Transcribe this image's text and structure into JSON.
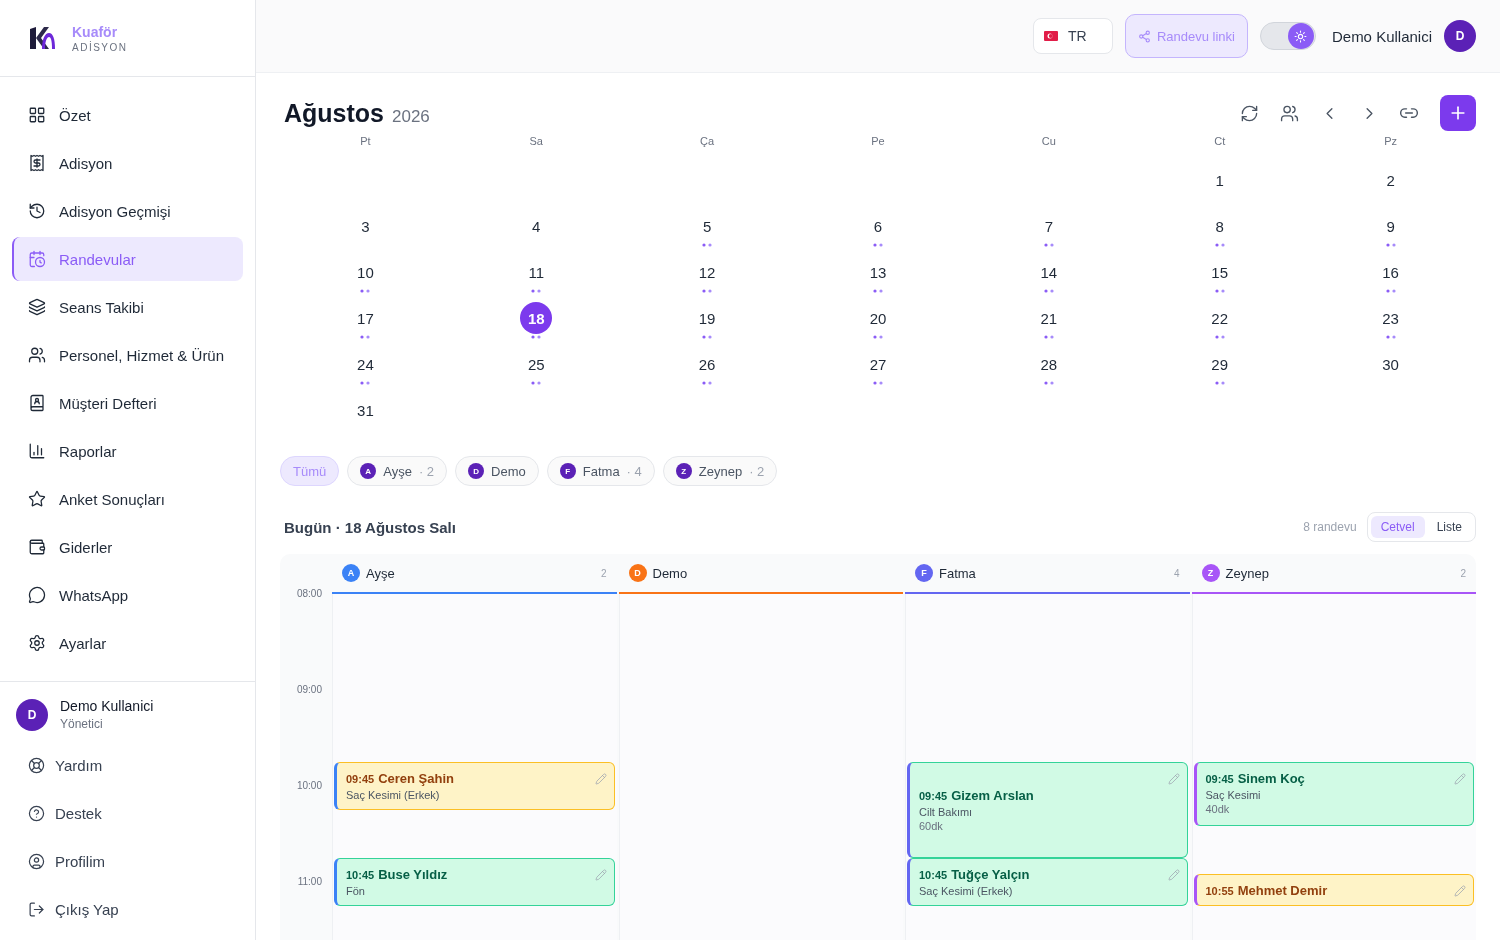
{
  "brand": {
    "name": "Kuaför",
    "subtitle": "ADİSYON"
  },
  "nav": [
    {
      "label": "Özet",
      "selected": false
    },
    {
      "label": "Adisyon",
      "selected": false
    },
    {
      "label": "Adisyon Geçmişi",
      "selected": false
    },
    {
      "label": "Randevular",
      "selected": true
    },
    {
      "label": "Seans Takibi",
      "selected": false
    },
    {
      "label": "Personel, Hizmet & Ürün",
      "selected": false
    },
    {
      "label": "Müşteri Defteri",
      "selected": false
    },
    {
      "label": "Raporlar",
      "selected": false
    },
    {
      "label": "Anket Sonuçları",
      "selected": false
    },
    {
      "label": "Giderler",
      "selected": false
    },
    {
      "label": "WhatsApp",
      "selected": false
    },
    {
      "label": "Ayarlar",
      "selected": false
    }
  ],
  "user": {
    "initial": "D",
    "name": "Demo Kullanici",
    "role": "Yönetici"
  },
  "footer_links": [
    "Yardım",
    "Destek",
    "Profilim",
    "Çıkış Yap"
  ],
  "topbar": {
    "language": "TR",
    "link_button": "Randevu linki",
    "theme_toggle": {
      "on": true
    },
    "user_name": "Demo Kullanici",
    "user_initial": "D"
  },
  "calendar": {
    "month": "Ağustos",
    "year": "2026",
    "weekdays": [
      "Pt",
      "Sa",
      "Ça",
      "Pe",
      "Cu",
      "Ct",
      "Pz"
    ],
    "weeks": [
      [
        {
          "day": "1",
          "events": false,
          "selected": false
        },
        {
          "day": "2",
          "events": false,
          "selected": false
        }
      ],
      [
        {
          "day": "3",
          "events": false,
          "selected": false
        },
        {
          "day": "4",
          "events": false,
          "selected": false
        },
        {
          "day": "5",
          "events": true,
          "selected": false
        },
        {
          "day": "6",
          "events": true,
          "selected": false
        },
        {
          "day": "7",
          "events": true,
          "selected": false
        },
        {
          "day": "8",
          "events": true,
          "selected": false
        },
        {
          "day": "9",
          "events": true,
          "selected": false
        }
      ],
      [
        {
          "day": "10",
          "events": true,
          "selected": false
        },
        {
          "day": "11",
          "events": true,
          "selected": false
        },
        {
          "day": "12",
          "events": true,
          "selected": false
        },
        {
          "day": "13",
          "events": true,
          "selected": false
        },
        {
          "day": "14",
          "events": true,
          "selected": false
        },
        {
          "day": "15",
          "events": true,
          "selected": false
        },
        {
          "day": "16",
          "events": true,
          "selected": false
        }
      ],
      [
        {
          "day": "17",
          "events": true,
          "selected": false
        },
        {
          "day": "18",
          "events": true,
          "selected": true
        },
        {
          "day": "19",
          "events": true,
          "selected": false
        },
        {
          "day": "20",
          "events": true,
          "selected": false
        },
        {
          "day": "21",
          "events": true,
          "selected": false
        },
        {
          "day": "22",
          "events": true,
          "selected": false
        },
        {
          "day": "23",
          "events": true,
          "selected": false
        }
      ],
      [
        {
          "day": "24",
          "events": true,
          "selected": false
        },
        {
          "day": "25",
          "events": true,
          "selected": false
        },
        {
          "day": "26",
          "events": true,
          "selected": false
        },
        {
          "day": "27",
          "events": true,
          "selected": false
        },
        {
          "day": "28",
          "events": true,
          "selected": false
        },
        {
          "day": "29",
          "events": true,
          "selected": false
        },
        {
          "day": "30",
          "events": false,
          "selected": false
        }
      ],
      [
        {
          "day": "31",
          "events": false,
          "selected": false
        }
      ]
    ]
  },
  "filters": [
    {
      "label": "Tümü",
      "selected": true
    },
    {
      "initial": "A",
      "label": "Ayşe",
      "count": "· 2",
      "selected": false
    },
    {
      "initial": "D",
      "label": "Demo",
      "selected": false
    },
    {
      "initial": "F",
      "label": "Fatma",
      "count": "· 4",
      "selected": false
    },
    {
      "initial": "Z",
      "label": "Zeynep",
      "count": "· 2",
      "selected": false
    }
  ],
  "day_title": "Bugün · 18 Ağustos Salı",
  "total": "8 randevu",
  "views": [
    {
      "label": "Cetvel",
      "selected": true
    },
    {
      "label": "Liste",
      "selected": false
    }
  ],
  "hours": [
    "08:00",
    "09:00",
    "10:00",
    "11:00"
  ],
  "staff": [
    {
      "initial": "A",
      "name": "Ayşe",
      "count": "2",
      "color": "#3b82f6",
      "appointments": [
        {
          "time": "09:45",
          "client": "Ceren Şahin",
          "service": "Saç Kesimi (Erkek)",
          "confirmed": false,
          "kind": "short"
        },
        {
          "time": "10:45",
          "client": "Buse Yıldız",
          "service": "Fön",
          "confirmed": true,
          "kind": "short"
        }
      ]
    },
    {
      "initial": "D",
      "name": "Demo",
      "color": "#f97316"
    },
    {
      "initial": "F",
      "name": "Fatma",
      "count": "4",
      "color": "#6366f1",
      "appointments": [
        {
          "time": "09:45",
          "client": "Gizem Arslan",
          "service": "Cilt Bakımı",
          "duration": "60dk",
          "confirmed": true,
          "kind": "long"
        },
        {
          "time": "10:45",
          "client": "Tuğçe Yalçın",
          "service": "Saç Kesimi (Erkek)",
          "confirmed": true,
          "kind": "short"
        }
      ]
    },
    {
      "initial": "Z",
      "name": "Zeynep",
      "count": "2",
      "color": "#a855f7",
      "appointments": [
        {
          "time": "09:45",
          "client": "Sinem Koç",
          "service": "Saç Kesimi",
          "duration": "40dk",
          "confirmed": true,
          "kind": "medium"
        },
        {
          "time": "10:55",
          "client": "Mehmet Demir",
          "confirmed": false,
          "kind": "brief"
        }
      ]
    }
  ]
}
